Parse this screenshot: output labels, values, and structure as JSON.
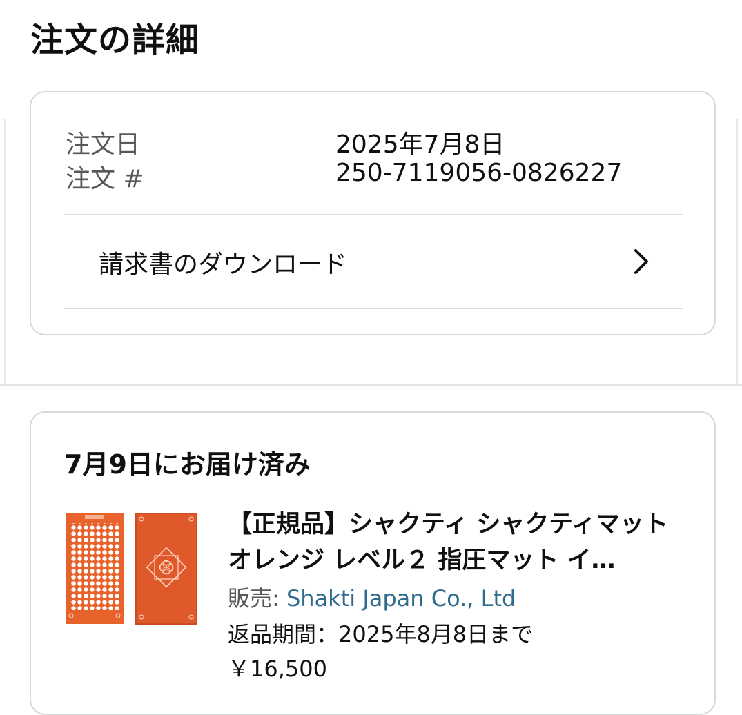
{
  "page": {
    "title": "注文の詳細"
  },
  "order_summary": {
    "order_date_label": "注文日",
    "order_date_value": "2025年7月8日",
    "order_number_label": "注文 #",
    "order_number_value": "250-7119056-0826227",
    "invoice_link_label": "請求書のダウンロード",
    "invoice_icon": "chevron-right-icon"
  },
  "shipment": {
    "status": "7月9日にお届け済み",
    "product": {
      "title": "【正規品】シャクティ シャクティマット オレンジ レベル２ 指圧マット イ…",
      "seller_label": "販売: ",
      "seller_name": "Shakti Japan Co., Ltd",
      "return_period": "返品期間：2025年8月8日まで",
      "price": "￥16,500",
      "image": "product-image",
      "colors": {
        "mat": "#e8622b",
        "mat_dark": "#c94f1e",
        "dots": "#ffffff",
        "seller_link": "#2f6b8c"
      }
    }
  }
}
